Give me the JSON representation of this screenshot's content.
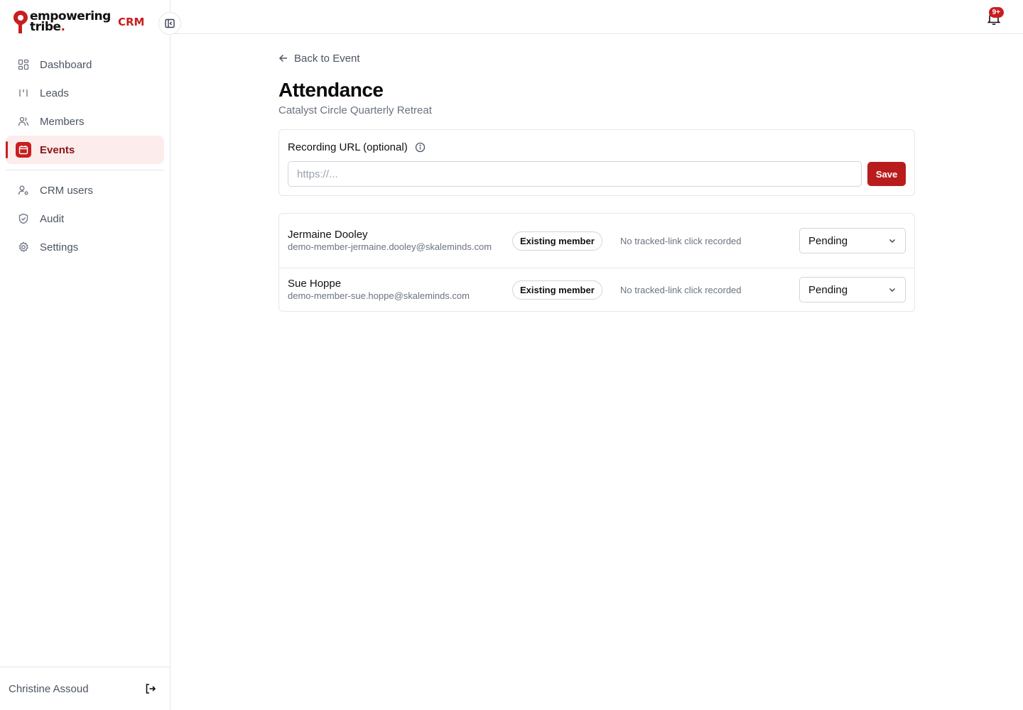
{
  "brand": {
    "line1": "empowering",
    "line2": "tribe",
    "dot": ".",
    "crm": "CRM"
  },
  "sidebar": {
    "items": [
      {
        "label": "Dashboard",
        "icon": "dashboard-icon"
      },
      {
        "label": "Leads",
        "icon": "leads-icon"
      },
      {
        "label": "Members",
        "icon": "members-icon"
      },
      {
        "label": "Events",
        "icon": "calendar-icon",
        "active": true
      }
    ],
    "secondary": [
      {
        "label": "CRM users",
        "icon": "user-cog-icon"
      },
      {
        "label": "Audit",
        "icon": "shield-icon"
      },
      {
        "label": "Settings",
        "icon": "gear-icon"
      }
    ],
    "user": "Christine Assoud"
  },
  "topbar": {
    "notification_count": "9+"
  },
  "page": {
    "back": "Back to Event",
    "title": "Attendance",
    "subtitle": "Catalyst Circle Quarterly Retreat"
  },
  "recording": {
    "label": "Recording URL (optional)",
    "placeholder": "https://...",
    "value": "",
    "save": "Save"
  },
  "attendees": [
    {
      "name": "Jermaine Dooley",
      "email": "demo-member-jermaine.dooley@skaleminds.com",
      "badge": "Existing member",
      "click": "No tracked-link click recorded",
      "status": "Pending"
    },
    {
      "name": "Sue Hoppe",
      "email": "demo-member-sue.hoppe@skaleminds.com",
      "badge": "Existing member",
      "click": "No tracked-link click recorded",
      "status": "Pending"
    }
  ],
  "colors": {
    "accent": "#c81e1e",
    "active_bg": "#fdecec"
  }
}
